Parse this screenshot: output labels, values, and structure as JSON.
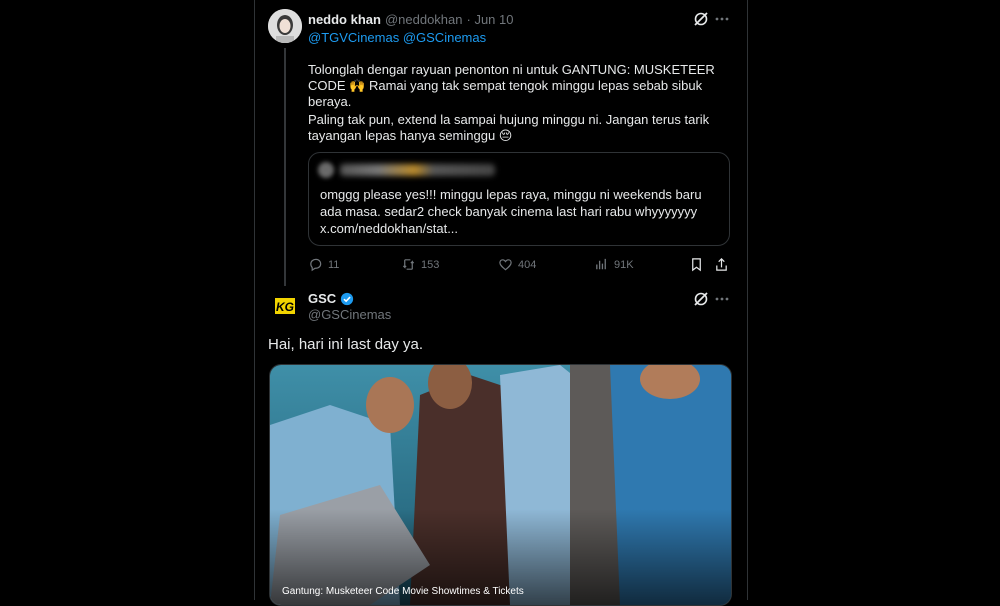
{
  "tweet1": {
    "name": "neddo khan",
    "handle": "@neddokhan",
    "date": "· Jun 10",
    "reply_to": "@TGVCinemas @GSCinemas",
    "text_p1": "Tolonglah dengar rayuan penonton ni untuk GANTUNG: MUSKETEER CODE 🙌 Ramai yang tak sempat tengok minggu lepas sebab sibuk beraya.",
    "text_p2": "Paling tak pun, extend la sampai hujung minggu ni. Jangan terus tarik tayangan lepas hanya seminggu 😔",
    "quote_text": "omggg please yes!!! minggu lepas raya, minggu ni weekends baru ada masa. sedar2 check banyak cinema last hari rabu whyyyyyyy x.com/neddokhan/stat...",
    "stats": {
      "replies": "11",
      "reposts": "153",
      "likes": "404",
      "views": "91K"
    }
  },
  "tweet2": {
    "name": "GSC",
    "handle": "@GSCinemas",
    "text": "Hai, hari ini last day ya.",
    "avatar_text": "KG",
    "media_caption": "Gantung: Musketeer Code Movie Showtimes & Tickets"
  },
  "colors": {
    "accent": "#1d9bf0",
    "muted": "#71767b",
    "text": "#e7e9ea",
    "background": "#000000"
  }
}
